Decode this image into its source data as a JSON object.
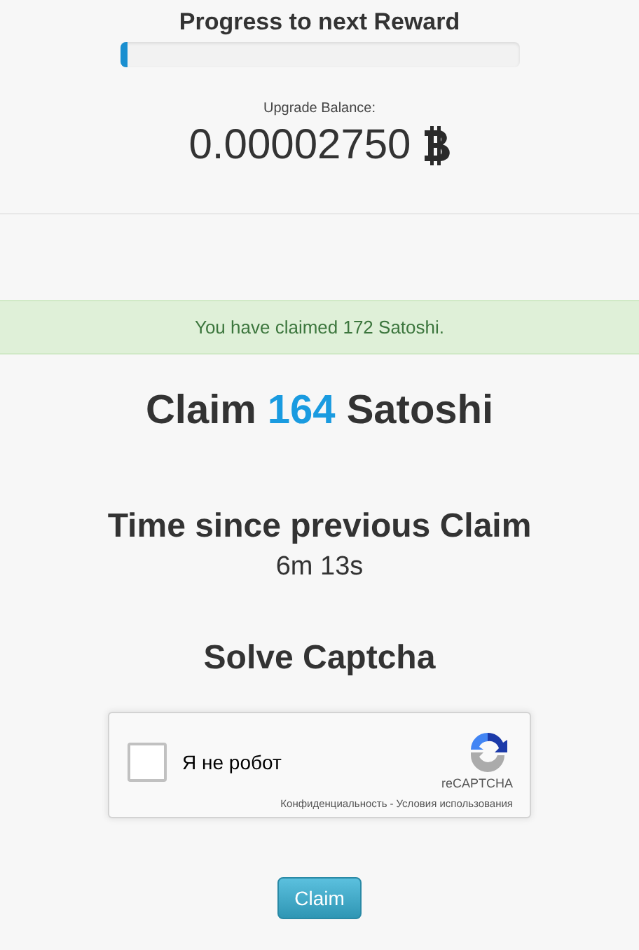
{
  "progress": {
    "title": "Progress to next Reward",
    "level": 0.02
  },
  "balance": {
    "label": "Upgrade Balance:",
    "value": "0.00002750"
  },
  "alert": {
    "text": "You have claimed 172 Satoshi."
  },
  "claim_heading": {
    "prefix": "Claim",
    "amount": "164",
    "suffix": "Satoshi"
  },
  "timer": {
    "title": "Time since previous Claim",
    "value": "6m 13s"
  },
  "captcha": {
    "title": "Solve Captcha",
    "checked": false,
    "label": "Я не робот",
    "brand": "reCAPTCHA",
    "privacy": "Конфиденциальность",
    "separator": "-",
    "terms": "Условия использования"
  },
  "button": {
    "label": "Claim"
  }
}
